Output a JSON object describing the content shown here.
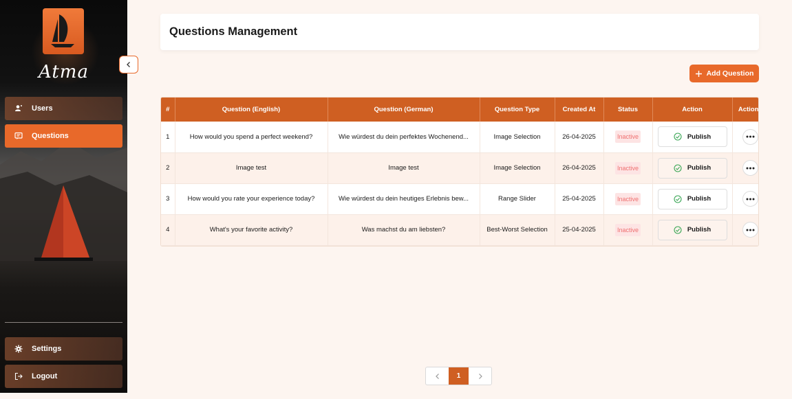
{
  "sidebar": {
    "brand": "Atma",
    "items": [
      {
        "label": "Users",
        "icon": "users-icon"
      },
      {
        "label": "Questions",
        "icon": "questions-icon",
        "active": true
      }
    ],
    "bottom_items": [
      {
        "label": "Settings",
        "icon": "gear-icon"
      },
      {
        "label": "Logout",
        "icon": "logout-icon"
      }
    ]
  },
  "header": {
    "title": "Questions Management"
  },
  "toolbar": {
    "add_label": "Add Question"
  },
  "table": {
    "columns": [
      "#",
      "Question (English)",
      "Question (German)",
      "Question Type",
      "Created At",
      "Status",
      "Action",
      "Actions"
    ],
    "rows": [
      {
        "num": "1",
        "en": "How would you spend a perfect weekend?",
        "de": "Wie würdest du dein perfektes Wochenend...",
        "type": "Image Selection",
        "created": "26-04-2025",
        "status": "Inactive",
        "action": "Publish"
      },
      {
        "num": "2",
        "en": "Image test",
        "de": "Image test",
        "type": "Image Selection",
        "created": "26-04-2025",
        "status": "Inactive",
        "action": "Publish"
      },
      {
        "num": "3",
        "en": "How would you rate your experience today?",
        "de": "Wie würdest du dein heutiges Erlebnis bew...",
        "type": "Range Slider",
        "created": "25-04-2025",
        "status": "Inactive",
        "action": "Publish"
      },
      {
        "num": "4",
        "en": "What's your favorite activity?",
        "de": "Was machst du am liebsten?",
        "type": "Best-Worst Selection",
        "created": "25-04-2025",
        "status": "Inactive",
        "action": "Publish"
      }
    ]
  },
  "pagination": {
    "current": "1"
  },
  "colors": {
    "accent": "#e8692a",
    "header": "#cf5f22",
    "inactive_text": "#ef6f6f",
    "inactive_bg": "#fde4e4"
  }
}
